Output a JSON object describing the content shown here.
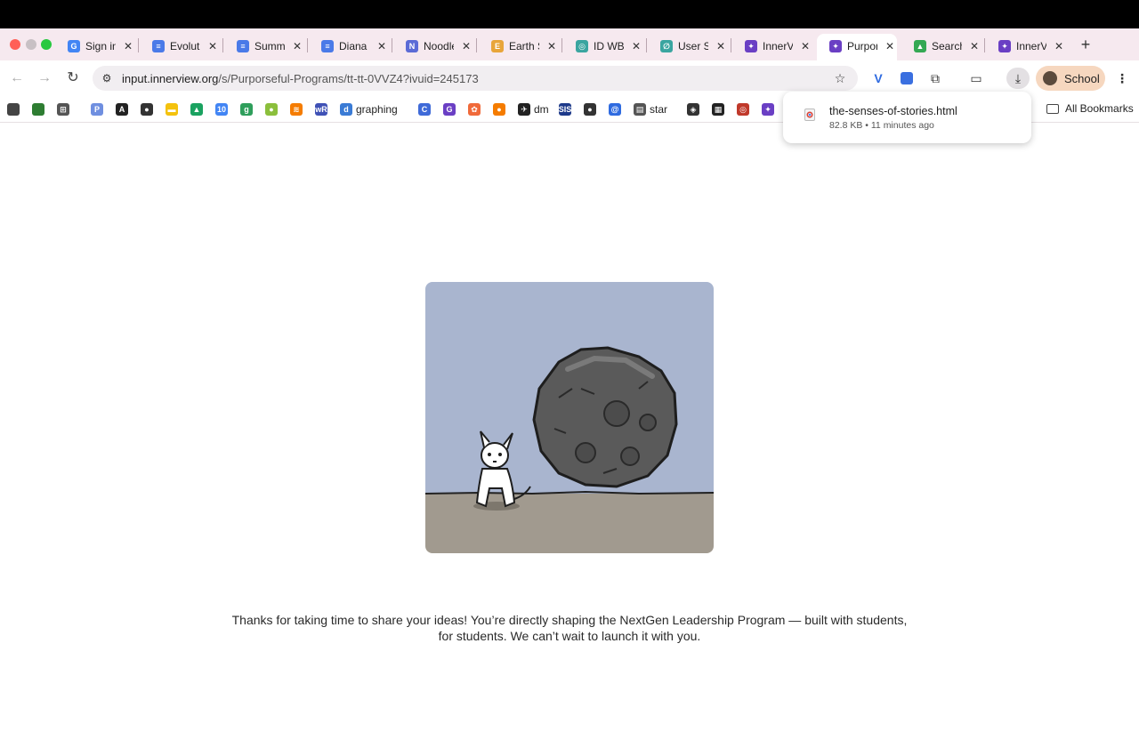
{
  "browser": {
    "tabs": [
      {
        "title": "Sign in",
        "favicon_color": "#4285f4",
        "favicon_glyph": "G"
      },
      {
        "title": "Evoluti",
        "favicon_color": "#4a7ae8",
        "favicon_glyph": "≡"
      },
      {
        "title": "Summ",
        "favicon_color": "#4a7ae8",
        "favicon_glyph": "≡"
      },
      {
        "title": "Diana",
        "favicon_color": "#4a7ae8",
        "favicon_glyph": "≡"
      },
      {
        "title": "Noodle",
        "favicon_color": "#5b6bd6",
        "favicon_glyph": "N"
      },
      {
        "title": "Earth S",
        "favicon_color": "#e8a53a",
        "favicon_glyph": "E"
      },
      {
        "title": "ID WB",
        "favicon_color": "#3aa5a0",
        "favicon_glyph": "◎"
      },
      {
        "title": "User S",
        "favicon_color": "#3aa5a0",
        "favicon_glyph": "∅"
      },
      {
        "title": "InnerV",
        "favicon_color": "#6a3fc4",
        "favicon_glyph": "✦"
      },
      {
        "title": "Purpor",
        "favicon_color": "#6a3fc4",
        "favicon_glyph": "✦"
      },
      {
        "title": "Search",
        "favicon_color": "#34a853",
        "favicon_glyph": "▲"
      },
      {
        "title": "InnerV",
        "favicon_color": "#6a3fc4",
        "favicon_glyph": "✦"
      }
    ],
    "active_tab_index": 9,
    "url_host": "input.innerview.org",
    "url_path": "/s/Purporseful-Programs/tt-tt-0VVZ4?ivuid=245173",
    "profile_label": "School",
    "bookmarks": [
      {
        "label": "",
        "color": "#444",
        "glyph": ""
      },
      {
        "label": "",
        "color": "#2e7d32",
        "glyph": ""
      },
      {
        "label": "",
        "color": "#555",
        "glyph": "⊞"
      },
      {
        "label": "",
        "color": "#6f8fe0",
        "glyph": "P"
      },
      {
        "label": "",
        "color": "#222",
        "glyph": "A"
      },
      {
        "label": "",
        "color": "#333",
        "glyph": "●"
      },
      {
        "label": "",
        "color": "#f4c20d",
        "glyph": "▬"
      },
      {
        "label": "",
        "color": "#1aa260",
        "glyph": "▲"
      },
      {
        "label": "",
        "color": "#4285f4",
        "glyph": "10"
      },
      {
        "label": "",
        "color": "#2e9e5b",
        "glyph": "g"
      },
      {
        "label": "",
        "color": "#8bbf3c",
        "glyph": "●"
      },
      {
        "label": "",
        "color": "#f57c00",
        "glyph": "≋"
      },
      {
        "label": "",
        "color": "#3f51b5",
        "glyph": "wR"
      },
      {
        "label": "graphing",
        "color": "#3a7bd5",
        "glyph": "d"
      },
      {
        "label": "",
        "color": "#3f6ad8",
        "glyph": "C"
      },
      {
        "label": "",
        "color": "#6a3fc4",
        "glyph": "G"
      },
      {
        "label": "",
        "color": "#f06a3a",
        "glyph": "✿"
      },
      {
        "label": "",
        "color": "#f57c00",
        "glyph": "●"
      },
      {
        "label": "dm",
        "color": "#222",
        "glyph": "✈"
      },
      {
        "label": "",
        "color": "#1e3a8a",
        "glyph": "SIS"
      },
      {
        "label": "",
        "color": "#333",
        "glyph": "●"
      },
      {
        "label": "",
        "color": "#2f6be0",
        "glyph": "@"
      },
      {
        "label": "star",
        "color": "#555",
        "glyph": "▤"
      },
      {
        "label": "",
        "color": "#333",
        "glyph": "◈"
      },
      {
        "label": "",
        "color": "#222",
        "glyph": "▦"
      },
      {
        "label": "",
        "color": "#c0392b",
        "glyph": "◎"
      },
      {
        "label": "",
        "color": "#6a3fc4",
        "glyph": "✦"
      },
      {
        "label": "",
        "color": "#3a7bd5",
        "glyph": "❂"
      }
    ],
    "all_bookmarks_label": "All Bookmarks"
  },
  "download": {
    "filename": "the-senses-of-stories.html",
    "meta": "82.8 KB • 11 minutes ago"
  },
  "page": {
    "message": "Thanks for taking  time to share your ideas! You’re directly shaping the NextGen Leadership Program — built with students, for students. We can’t wait to launch it with you."
  },
  "colors": {
    "sky": "#a9b5cf",
    "ground": "#a19a8f",
    "rock": "#5a5a5a",
    "tabstrip": "#f6e9ef"
  }
}
